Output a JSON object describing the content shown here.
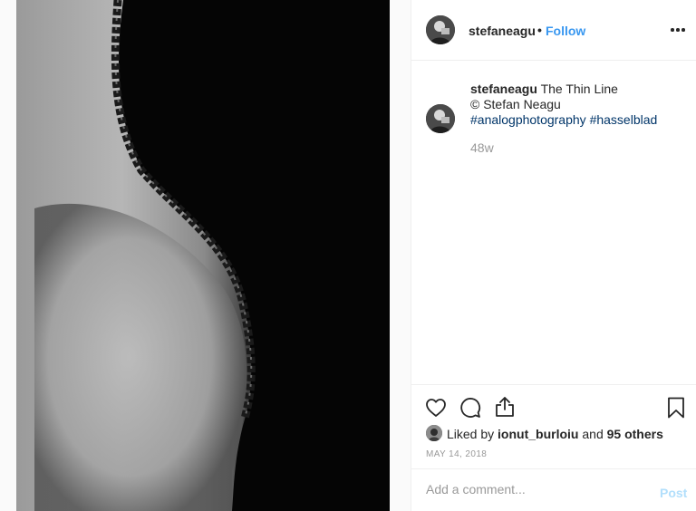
{
  "post": {
    "image_alt": "Black and white photograph of a curved torso silhouette with a beaded line",
    "author": {
      "username": "stefaneagu",
      "avatar_icon": "user-avatar"
    },
    "follow_separator": "•",
    "follow_label": "Follow",
    "more_icon": "more-horizontal-icon",
    "caption": {
      "username": "stefaneagu",
      "title": "The Thin Line",
      "credit": "© Stefan Neagu",
      "hashtags": [
        "#analogphotography",
        "#hasselblad"
      ]
    },
    "time_ago": "48w",
    "actions": {
      "like_icon": "heart-icon",
      "comment_icon": "comment-icon",
      "share_icon": "share-icon",
      "save_icon": "bookmark-icon"
    },
    "likes": {
      "prefix": "Liked by",
      "user": "ionut_burloiu",
      "and": "and",
      "others": "95 others"
    },
    "date": "MAY 14, 2018",
    "comment_placeholder": "Add a comment...",
    "post_label": "Post"
  },
  "colors": {
    "link": "#3897f0",
    "hashtag": "#003569",
    "muted": "#999999",
    "post_disabled": "#b2dffc",
    "text": "#262626"
  }
}
